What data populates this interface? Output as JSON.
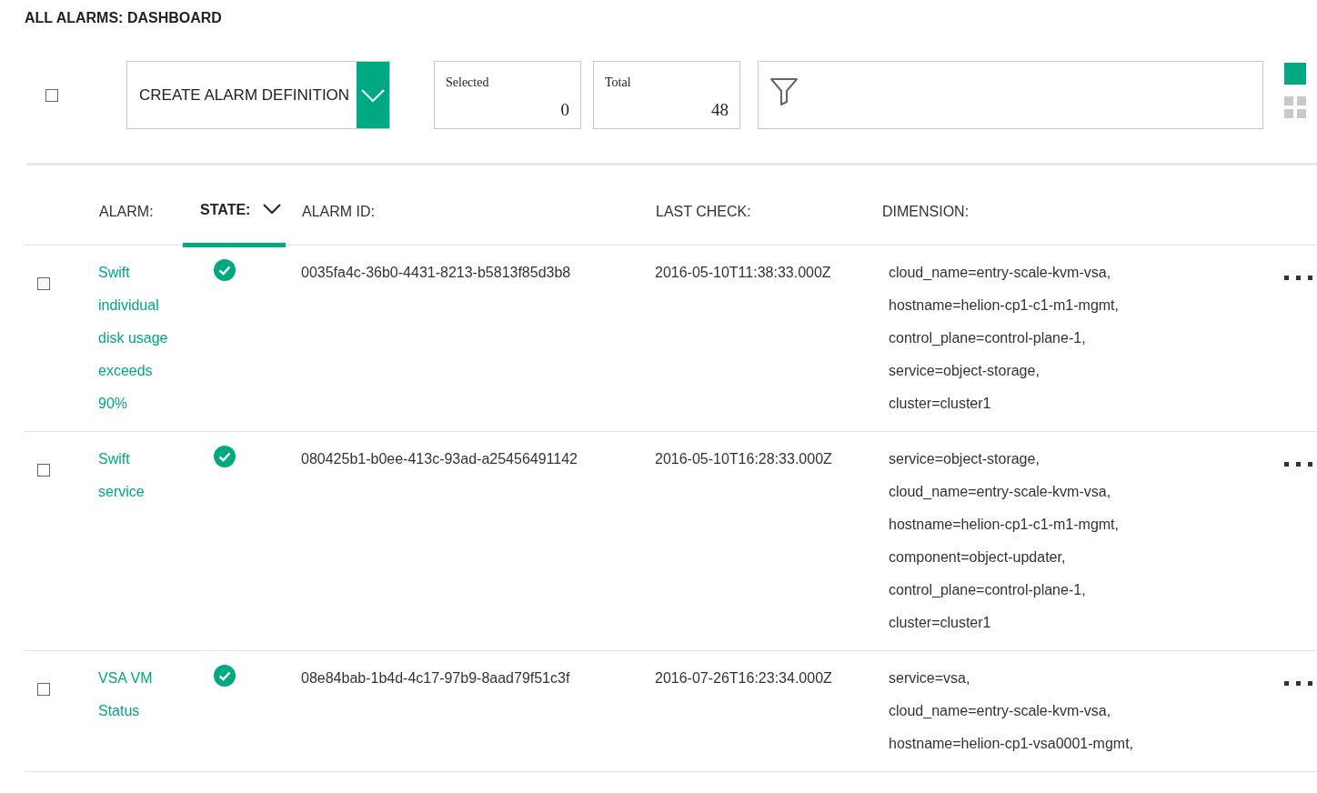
{
  "title": "ALL ALARMS: DASHBOARD",
  "toolbar": {
    "select_all": {
      "checked": false
    },
    "create_button": {
      "label": "CREATE ALARM DEFINITION"
    },
    "counters": [
      {
        "label": "Selected",
        "value": "0"
      },
      {
        "label": "Total",
        "value": "48"
      }
    ],
    "views": [
      {
        "kind": "list",
        "selected": true
      },
      {
        "kind": "grid",
        "selected": false
      }
    ]
  },
  "table": {
    "columns": [
      {
        "label": "ALARM:",
        "selected": false
      },
      {
        "label": "STATE:",
        "selected": true
      },
      {
        "label": "ALARM ID:",
        "selected": false
      },
      {
        "label": "LAST CHECK:",
        "selected": false
      },
      {
        "label": "DIMENSION:",
        "selected": false
      }
    ],
    "rows": [
      {
        "checked": false,
        "alarm": "Swift individual disk usage exceeds 90%",
        "healthy": true,
        "alarm_id": "0035fa4c-36b0-4431-8213-b5813f85d3b8",
        "last_check": "2016-05-10T11:38:33.000Z",
        "dimension": [
          "cloud_name=entry-scale-kvm-vsa,",
          "hostname=helion-cp1-c1-m1-mgmt,",
          "control_plane=control-plane-1,",
          "service=object-storage,",
          "cluster=cluster1"
        ]
      },
      {
        "checked": false,
        "alarm": "Swift service",
        "healthy": true,
        "alarm_id": "080425b1-b0ee-413c-93ad-a25456491142",
        "last_check": "2016-05-10T16:28:33.000Z",
        "dimension": [
          "service=object-storage,",
          "cloud_name=entry-scale-kvm-vsa,",
          "hostname=helion-cp1-c1-m1-mgmt,",
          "component=object-updater,",
          "control_plane=control-plane-1,",
          "cluster=cluster1"
        ]
      },
      {
        "checked": false,
        "alarm": "VSA VM Status",
        "healthy": true,
        "alarm_id": "08e84bab-1b4d-4c17-97b9-8aad79f51c3f",
        "last_check": "2016-07-26T16:23:34.000Z",
        "dimension": [
          "service=vsa,",
          "cloud_name=entry-scale-kvm-vsa,",
          "hostname=helion-cp1-vsa0001-mgmt,"
        ]
      }
    ]
  }
}
